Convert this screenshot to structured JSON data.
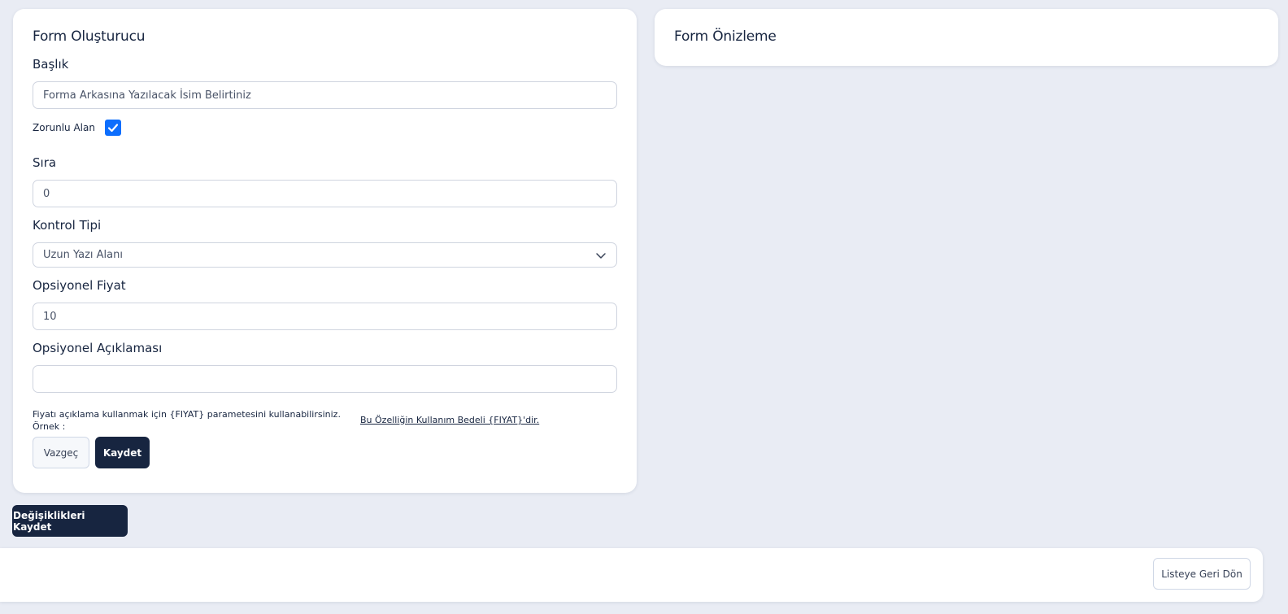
{
  "builder": {
    "title": "Form Oluşturucu",
    "baslik_label": "Başlık",
    "baslik_value": "Forma Arkasına Yazılacak İsim Belirtiniz",
    "zorunlu_label": "Zorunlu Alan",
    "zorunlu_checked": true,
    "sira_label": "Sıra",
    "sira_value": "0",
    "kontrol_label": "Kontrol Tipi",
    "kontrol_value": "Uzun Yazı Alanı",
    "fiyat_label": "Opsiyonel Fiyat",
    "fiyat_value": "10",
    "aciklama_label": "Opsiyonel Açıklaması",
    "aciklama_value": "",
    "help_text": "Fiyatı açıklama kullanmak için {FIYAT} parametesini kullanabilirsiniz.",
    "help_example": "Örnek :",
    "help_link": "Bu Özelliğin Kullanım Bedeli {FIYAT}'dir.",
    "cancel_label": "Vazgeç",
    "save_label": "Kaydet"
  },
  "preview": {
    "title": "Form Önizleme"
  },
  "save_changes_label": "Değişiklikleri Kaydet",
  "back_to_list_label": "Listeye Geri Dön",
  "colors": {
    "primary": "#172540",
    "checkbox": "#0d6efd",
    "background": "#e9ecf4"
  },
  "icons": {
    "checkbox": "check-icon",
    "select": "chevron-down-icon"
  }
}
